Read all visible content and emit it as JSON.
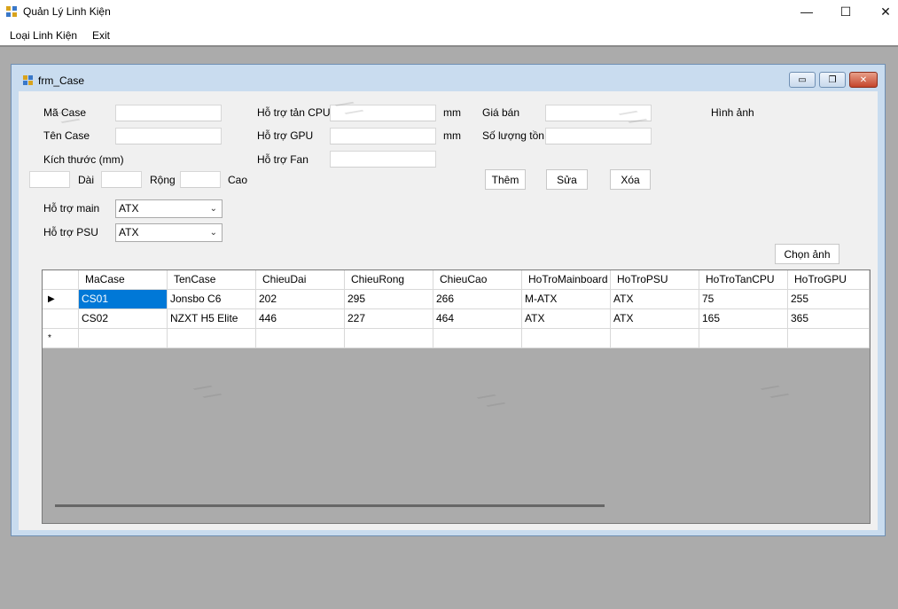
{
  "app": {
    "title": "Quản Lý Linh Kiện",
    "menu": [
      "Loại Linh Kiện",
      "Exit"
    ],
    "controls": {
      "minimize": "—",
      "maximize": "☐",
      "close": "✕"
    }
  },
  "form": {
    "title": "frm_Case",
    "controls": {
      "minimize": "▭",
      "restore": "❐",
      "close": "✕"
    },
    "labels": {
      "ma_case": "Mã Case",
      "ten_case": "Tên Case",
      "kich_thuoc": "Kích thước (mm)",
      "dai": "Dài",
      "rong": "Rộng",
      "cao": "Cao",
      "ho_tro_main": "Hỗ trợ main",
      "ho_tro_psu": "Hỗ trợ PSU",
      "ho_tro_tan_cpu": "Hỗ trợ tản CPU",
      "ho_tro_gpu": "Hỗ trợ GPU",
      "ho_tro_fan": "Hỗ trợ Fan",
      "mm1": "mm",
      "mm2": "mm",
      "gia_ban": "Giá bán",
      "so_luong_ton": "Số lượng tồn",
      "hinh_anh": "Hình ảnh"
    },
    "combos": {
      "main": "ATX",
      "psu": "ATX"
    },
    "buttons": {
      "them": "Thêm",
      "sua": "Sửa",
      "xoa": "Xóa",
      "chon_anh": "Chọn ảnh"
    }
  },
  "grid": {
    "columns": [
      "MaCase",
      "TenCase",
      "ChieuDai",
      "ChieuRong",
      "ChieuCao",
      "HoTroMainboard",
      "HoTroPSU",
      "HoTroTanCPU",
      "HoTroGPU"
    ],
    "rows": [
      [
        "CS01",
        "Jonsbo C6",
        "202",
        "295",
        "266",
        "M-ATX",
        "ATX",
        "75",
        "255"
      ],
      [
        "CS02",
        "NZXT H5 Elite",
        "446",
        "227",
        "464",
        "ATX",
        "ATX",
        "165",
        "365"
      ]
    ],
    "current_row_marker": "▶",
    "new_row_marker": "*"
  },
  "colors": {
    "selection": "#0078d7",
    "mdi_background": "#ababab",
    "form_border": "#c9dcef"
  }
}
